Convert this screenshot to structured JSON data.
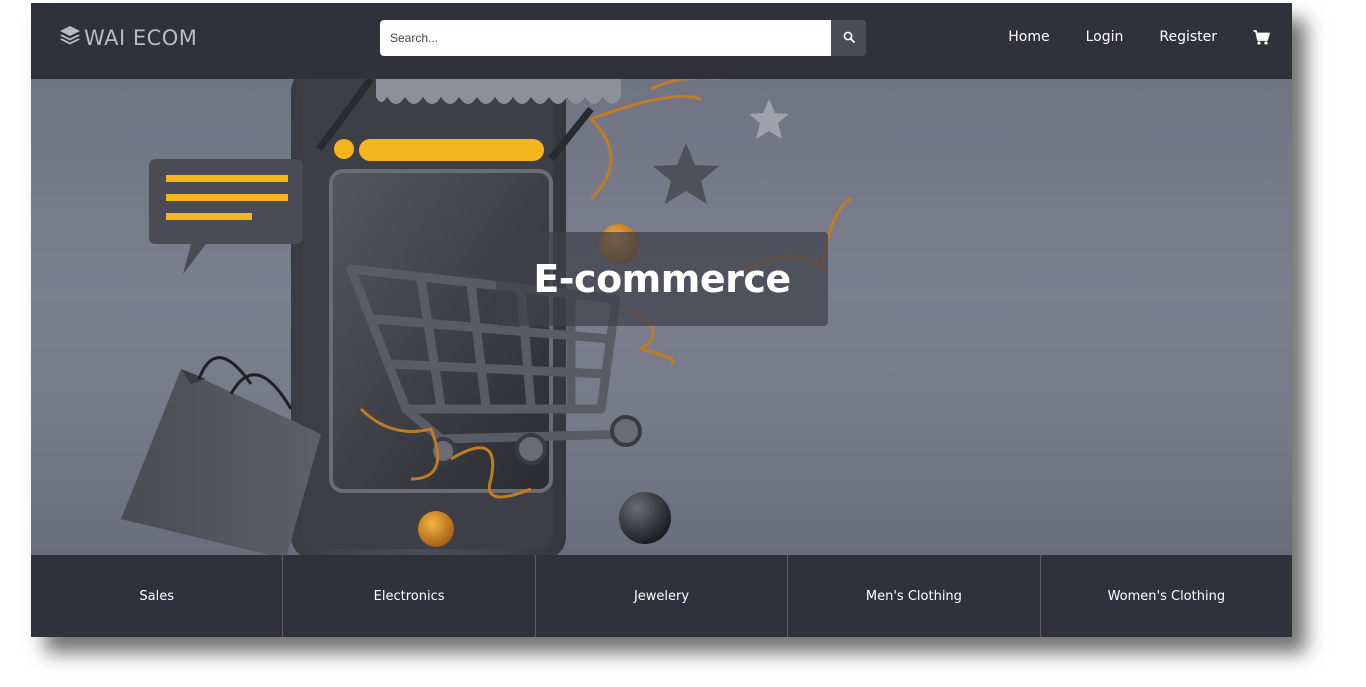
{
  "navbar": {
    "brand": "WAI ECOM",
    "brand_icon": "layers-icon",
    "search": {
      "placeholder": "Search...",
      "value": "",
      "icon": "search-icon"
    },
    "links": [
      "Home",
      "Login",
      "Register"
    ],
    "cart_icon": "cart-icon"
  },
  "hero": {
    "title": "E-commerce"
  },
  "categories": [
    "Sales",
    "Electronics",
    "Jewelery",
    "Men's Clothing",
    "Women's Clothing"
  ],
  "colors": {
    "navbar_bg": "#30313c",
    "hero_bg": "#767a89",
    "accent_yellow": "#f5b51c",
    "category_bg": "#30313c",
    "text": "#ffffff"
  }
}
